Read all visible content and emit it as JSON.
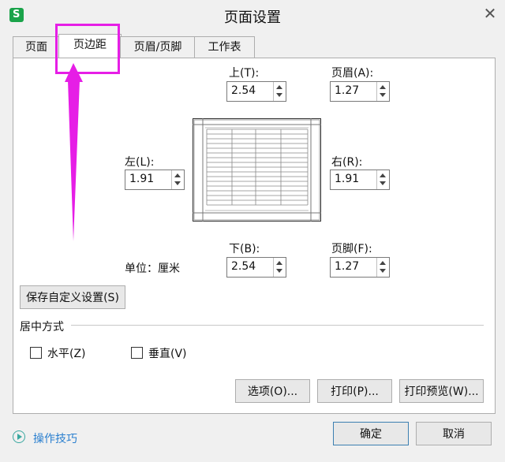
{
  "window": {
    "title": "页面设置",
    "close_glyph": "✕"
  },
  "tabs": [
    {
      "label": "页面"
    },
    {
      "label": "页边距"
    },
    {
      "label": "页眉/页脚"
    },
    {
      "label": "工作表"
    }
  ],
  "margins": {
    "top": {
      "label": "上(T):",
      "value": "2.54"
    },
    "header": {
      "label": "页眉(A):",
      "value": "1.27"
    },
    "left": {
      "label": "左(L):",
      "value": "1.91"
    },
    "right": {
      "label": "右(R):",
      "value": "1.91"
    },
    "bottom": {
      "label": "下(B):",
      "value": "2.54"
    },
    "footer": {
      "label": "页脚(F):",
      "value": "1.27"
    }
  },
  "unit_label": "单位：厘米",
  "save_custom_button": "保存自定义设置(S)",
  "center": {
    "title": "居中方式",
    "horizontal": "水平(Z)",
    "vertical": "垂直(V)"
  },
  "actions": {
    "options": "选项(O)...",
    "print": "打印(P)...",
    "print_preview": "打印预览(W)..."
  },
  "footer": {
    "tips": "操作技巧",
    "ok": "确定",
    "cancel": "取消"
  },
  "annotation_color": "#e61ee6"
}
